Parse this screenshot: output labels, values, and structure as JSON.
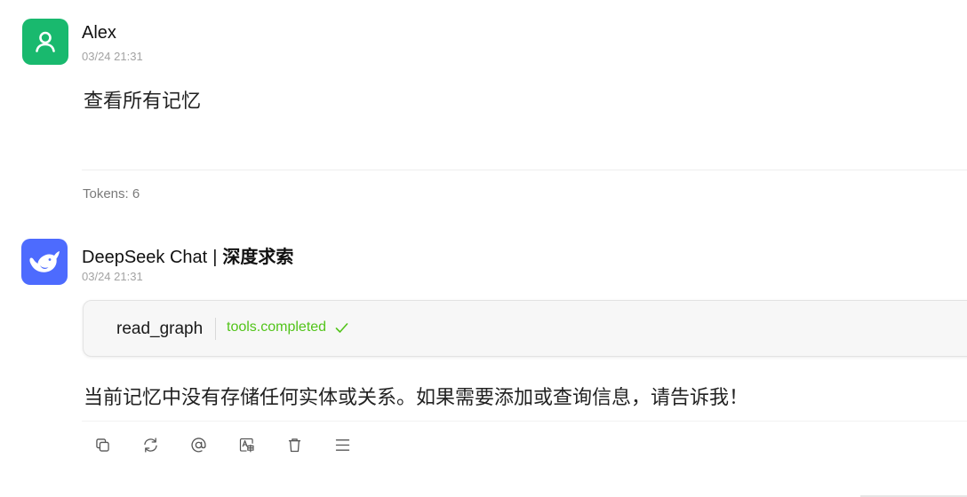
{
  "user_message": {
    "author": "Alex",
    "timestamp": "03/24 21:31",
    "text": "查看所有记忆",
    "tokens_label": "Tokens: 6",
    "avatar_icon": "user-icon",
    "avatar_color": "#19b96e"
  },
  "assistant_message": {
    "model_name": "DeepSeek Chat",
    "separator": "|",
    "provider_name": "深度求索",
    "timestamp": "03/24 21:31",
    "avatar_icon": "deepseek-whale-icon",
    "avatar_color": "#4d6bfe",
    "tool_call": {
      "name": "read_graph",
      "status": "tools.completed",
      "status_icon": "check-icon",
      "status_color": "#52c41a"
    },
    "text": "当前记忆中没有存储任何实体或关系。如果需要添加或查询信息，请告诉我！"
  },
  "message_actions": [
    {
      "icon": "copy-icon"
    },
    {
      "icon": "regenerate-icon"
    },
    {
      "icon": "mention-icon"
    },
    {
      "icon": "translate-icon"
    },
    {
      "icon": "delete-icon"
    },
    {
      "icon": "more-menu-icon"
    }
  ]
}
